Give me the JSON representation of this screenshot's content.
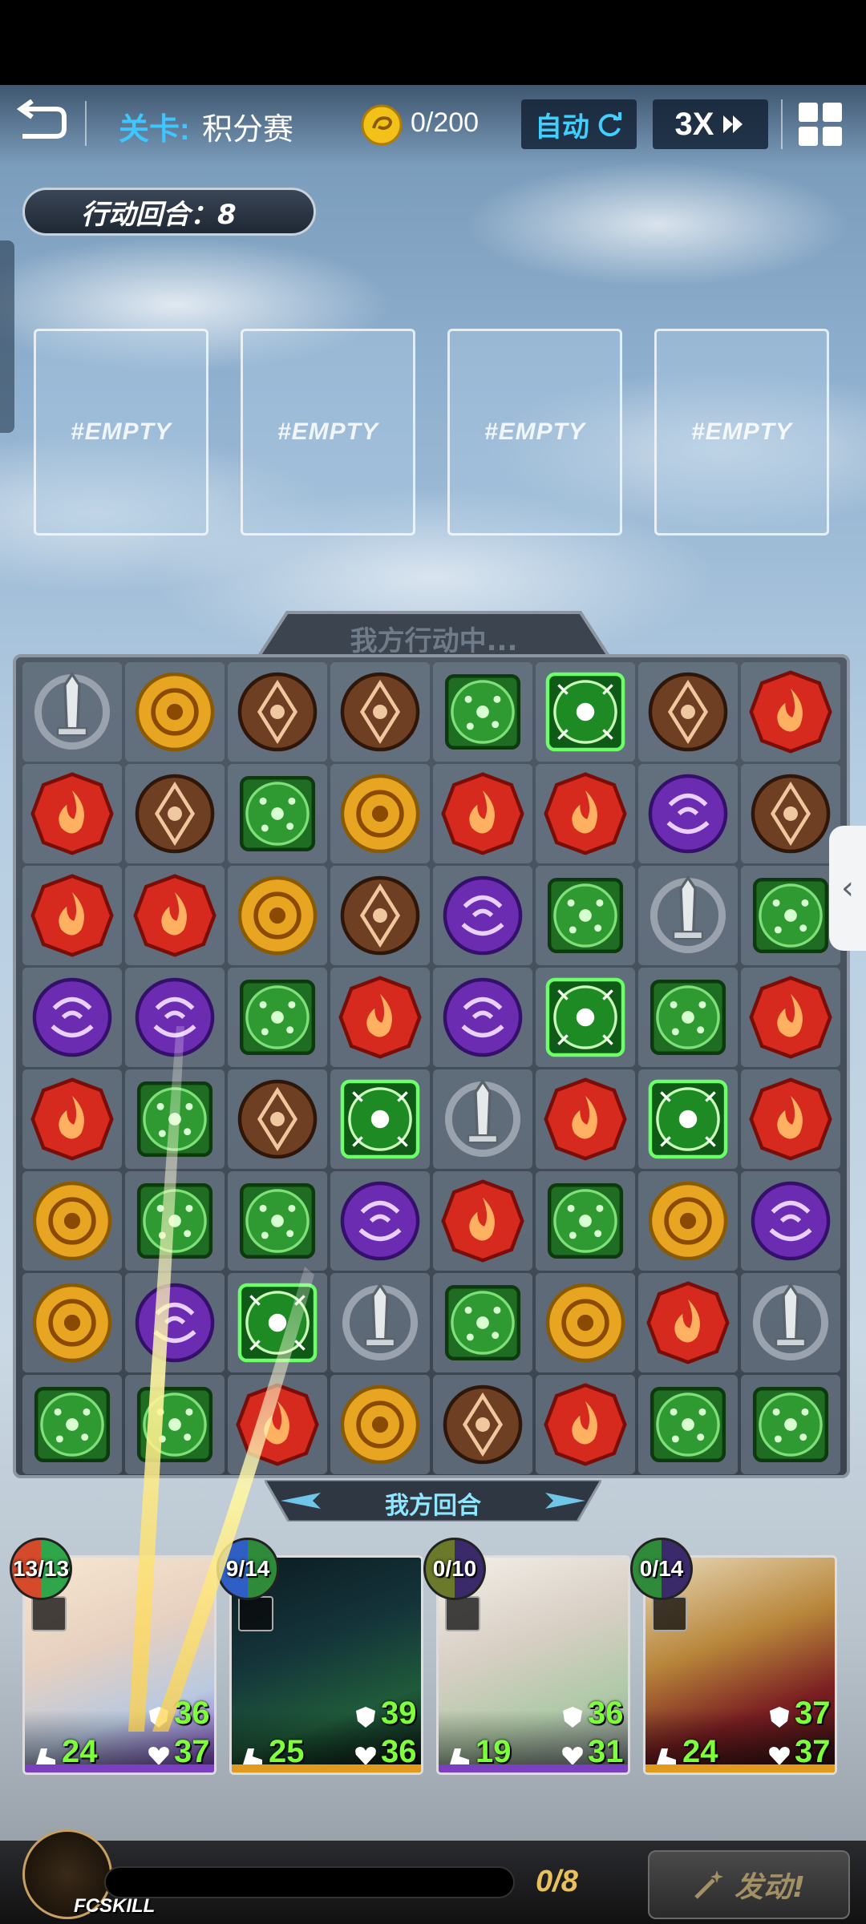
{
  "header": {
    "stage_prefix": "关卡:",
    "stage_name": "积分赛",
    "coins": "0/200",
    "auto_label": "自动",
    "speed_label": "3X"
  },
  "round": {
    "label": "行动回合：8"
  },
  "slots": [
    {
      "label": "#EMPTY"
    },
    {
      "label": "#EMPTY"
    },
    {
      "label": "#EMPTY"
    },
    {
      "label": "#EMPTY"
    }
  ],
  "board": {
    "header_label": "我方行动中...",
    "footer_label": "我方回合",
    "rows": 8,
    "cols": 8,
    "grid": [
      [
        "sword",
        "sun",
        "earth",
        "earth",
        "leaf",
        "leaf-glow",
        "earth",
        "fire"
      ],
      [
        "fire",
        "earth",
        "leaf",
        "sun",
        "fire",
        "fire",
        "dark",
        "earth"
      ],
      [
        "fire",
        "fire",
        "sun",
        "earth",
        "dark",
        "leaf",
        "sword",
        "leaf"
      ],
      [
        "dark",
        "dark",
        "leaf",
        "fire",
        "dark",
        "leaf-glow",
        "leaf",
        "fire"
      ],
      [
        "fire",
        "leaf",
        "earth",
        "leaf-glow",
        "sword",
        "fire",
        "leaf-glow",
        "fire"
      ],
      [
        "sun",
        "leaf",
        "leaf",
        "dark",
        "fire",
        "leaf",
        "sun",
        "dark"
      ],
      [
        "sun",
        "dark",
        "leaf-glow",
        "sword",
        "leaf",
        "sun",
        "fire",
        "sword"
      ],
      [
        "leaf",
        "leaf",
        "fire",
        "sun",
        "earth",
        "fire",
        "leaf",
        "leaf"
      ]
    ]
  },
  "heroes": [
    {
      "energy": "13/13",
      "shield": "36",
      "hp": "37",
      "speed": "24",
      "element_color": "#7b3fc4",
      "energy_colors": [
        "#2fa64a",
        "#d44a2a"
      ]
    },
    {
      "energy": "9/14",
      "shield": "39",
      "hp": "36",
      "speed": "25",
      "element_color": "#e29a1e",
      "energy_colors": [
        "#2f8a3a",
        "#2f5fc4"
      ]
    },
    {
      "energy": "0/10",
      "shield": "36",
      "hp": "31",
      "speed": "19",
      "element_color": "#7b3fc4",
      "energy_colors": [
        "#3a2a6a",
        "#6b7a2a"
      ]
    },
    {
      "energy": "0/14",
      "shield": "37",
      "hp": "37",
      "speed": "24",
      "element_color": "#e29a1e",
      "energy_colors": [
        "#3a2a6a",
        "#2f8a3a"
      ]
    }
  ],
  "bottom": {
    "fc_label": "FCSKILL",
    "skill_progress": "0/8",
    "launch_label": "发动!"
  },
  "colors": {
    "fire": "#d62a1e",
    "leaf": "#2f9a32",
    "sun": "#e7a521",
    "earth": "#6e3f22",
    "dark": "#6b2cb2",
    "sword": "#9aa3ad",
    "accent": "#3fc6ff"
  }
}
